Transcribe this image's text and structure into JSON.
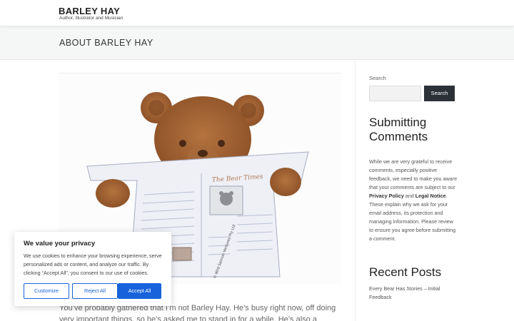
{
  "header": {
    "site_title": "BARLEY HAY",
    "tagline": "Author, Illustrator and Musician"
  },
  "page": {
    "title": "ABOUT BARLEY HAY",
    "intro": "You’ve probably gathered that I’m not Barley Hay. He’s busy right now, off doing very important things, so he’s asked me to stand in for a while. He’s also a modest person"
  },
  "image": {
    "newspaper_masthead": "The Bear Times",
    "credit": "© Wild Salmon Ventures Pty Ltd"
  },
  "sidebar": {
    "search_label": "Search",
    "search_placeholder": "",
    "search_button": "Search",
    "widget1_title": "Submitting Comments",
    "widget1_text_before": "While we are very grateful to receive comments, especially positive feedback, we need to make you aware that your comments are subject to our ",
    "widget1_link1": "Privacy Policy",
    "widget1_text_mid": " and ",
    "widget1_link2": "Legal Notice",
    "widget1_text_after": ". These explain why we ask for your email address, its protection and managing information. Please review to ensure you agree before submitting a comment.",
    "widget2_title": "Recent Posts",
    "recent_posts": [
      "Every Bear Has Stories – Initial Feedback"
    ]
  },
  "cookie": {
    "title": "We value your privacy",
    "text": "We use cookies to enhance your browsing experience, serve personalized ads or content, and analyze our traffic. By clicking “Accept All”, you consent to our use of cookies.",
    "customize": "Customize",
    "reject": "Reject All",
    "accept": "Accept All"
  },
  "colors": {
    "accent": "#1863dc",
    "search_button_bg": "#2c3137"
  }
}
